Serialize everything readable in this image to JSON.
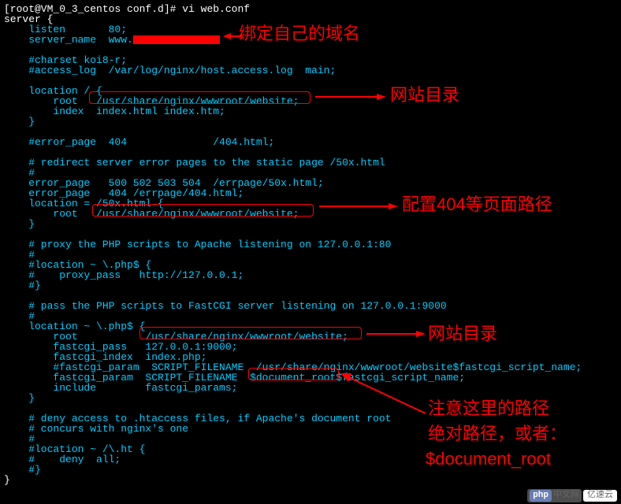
{
  "prompt": "[root@VM_0_3_centos conf.d]# vi web.conf",
  "config": {
    "server_open": "server {",
    "listen": "    listen       80;",
    "server_name_prefix": "    server_name  www.",
    "blank1": "",
    "charset": "    #charset koi8-r;",
    "access_log": "    #access_log  /var/log/nginx/host.access.log  main;",
    "blank2": "",
    "location_root": "    location / {",
    "root1_prefix": "        root   ",
    "root1_path": "/usr/share/nginx/wwwroot/website;",
    "index1": "        index  index.html index.htm;",
    "close1": "    }",
    "blank3": "",
    "error_page_404": "    #error_page  404              /404.html;",
    "blank4": "",
    "redirect_comment": "    # redirect server error pages to the static page /50x.html",
    "hash1": "    #",
    "error_page_500": "    error_page   500 502 503 504  /errpage/50x.html;",
    "error_page_404b": "    error_page   404 /errpage/404.html;",
    "location_50x": "    location = /50x.html {",
    "root2_prefix": "        root   ",
    "root2_path": "/usr/share/nginx/wwwroot/website;",
    "close2": "    }",
    "blank5": "",
    "proxy_comment": "    # proxy the PHP scripts to Apache listening on 127.0.0.1:80",
    "hash2": "    #",
    "location_php_proxy": "    #location ~ \\.php$ {",
    "proxy_pass": "    #    proxy_pass   http://127.0.0.1;",
    "close3": "    #}",
    "blank6": "",
    "fastcgi_comment": "    # pass the PHP scripts to FastCGI server listening on 127.0.0.1:9000",
    "hash3": "    #",
    "location_php": "    location ~ \\.php$ {",
    "root3_prefix": "        root           ",
    "root3_path": "/usr/share/nginx/wwwroot/website;",
    "fastcgi_pass": "        fastcgi_pass   127.0.0.1:9000;",
    "fastcgi_index": "        fastcgi_index  index.php;",
    "fastcgi_param1": "        #fastcgi_param  SCRIPT_FILENAME  /usr/share/nginx/wwwroot/website$fastcgi_script_name;",
    "fastcgi_param2_prefix": "        fastcgi_param  SCRIPT_FILENAME  ",
    "fastcgi_param2_var": "$document_root",
    "fastcgi_param2_suffix": "$fastcgi_script_name;",
    "include": "        include        fastcgi_params;",
    "close4": "    }",
    "blank7": "",
    "deny_comment1": "    # deny access to .htaccess files, if Apache's document root",
    "deny_comment2": "    # concurs with nginx's one",
    "hash4": "    #",
    "location_ht": "    #location ~ /\\.ht {",
    "deny_all": "    #    deny  all;",
    "close5": "    #}",
    "server_close": "}"
  },
  "annotations": {
    "a1": "绑定自己的域名",
    "a2": "网站目录",
    "a3": "配置404等页面路径",
    "a4": "网站目录",
    "a5_l1": "注意这里的路径",
    "a5_l2": "绝对路径，或者：",
    "a5_l3": "$document_root"
  },
  "watermark": {
    "php": "php",
    "phpcn": "中文网",
    "yy": "亿速云"
  }
}
